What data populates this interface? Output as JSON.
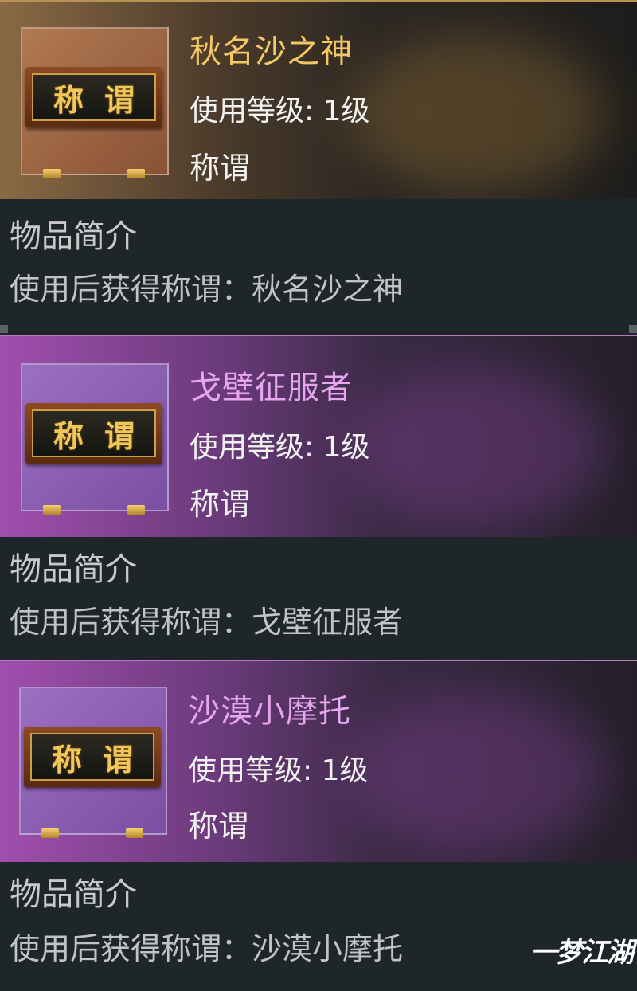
{
  "items": [
    {
      "name": "秋名沙之神",
      "level": "使用等级: 1级",
      "type": "称谓",
      "desc_title": "物品简介",
      "desc_text": "使用后获得称谓：秋名沙之神",
      "plaque": [
        "称",
        "谓"
      ],
      "name_color": "#f4c862",
      "theme": "gold"
    },
    {
      "name": "戈壁征服者",
      "level": "使用等级: 1级",
      "type": "称谓",
      "desc_title": "物品简介",
      "desc_text": "使用后获得称谓：戈壁征服者",
      "plaque": [
        "称",
        "谓"
      ],
      "name_color": "#e7a6ef",
      "theme": "purple"
    },
    {
      "name": "沙漠小摩托",
      "level": "使用等级: 1级",
      "type": "称谓",
      "desc_title": "物品简介",
      "desc_text": "使用后获得称谓：沙漠小摩托",
      "plaque": [
        "称",
        "谓"
      ],
      "name_color": "#e7a6ef",
      "theme": "purple"
    }
  ],
  "watermark": "一梦江湖"
}
